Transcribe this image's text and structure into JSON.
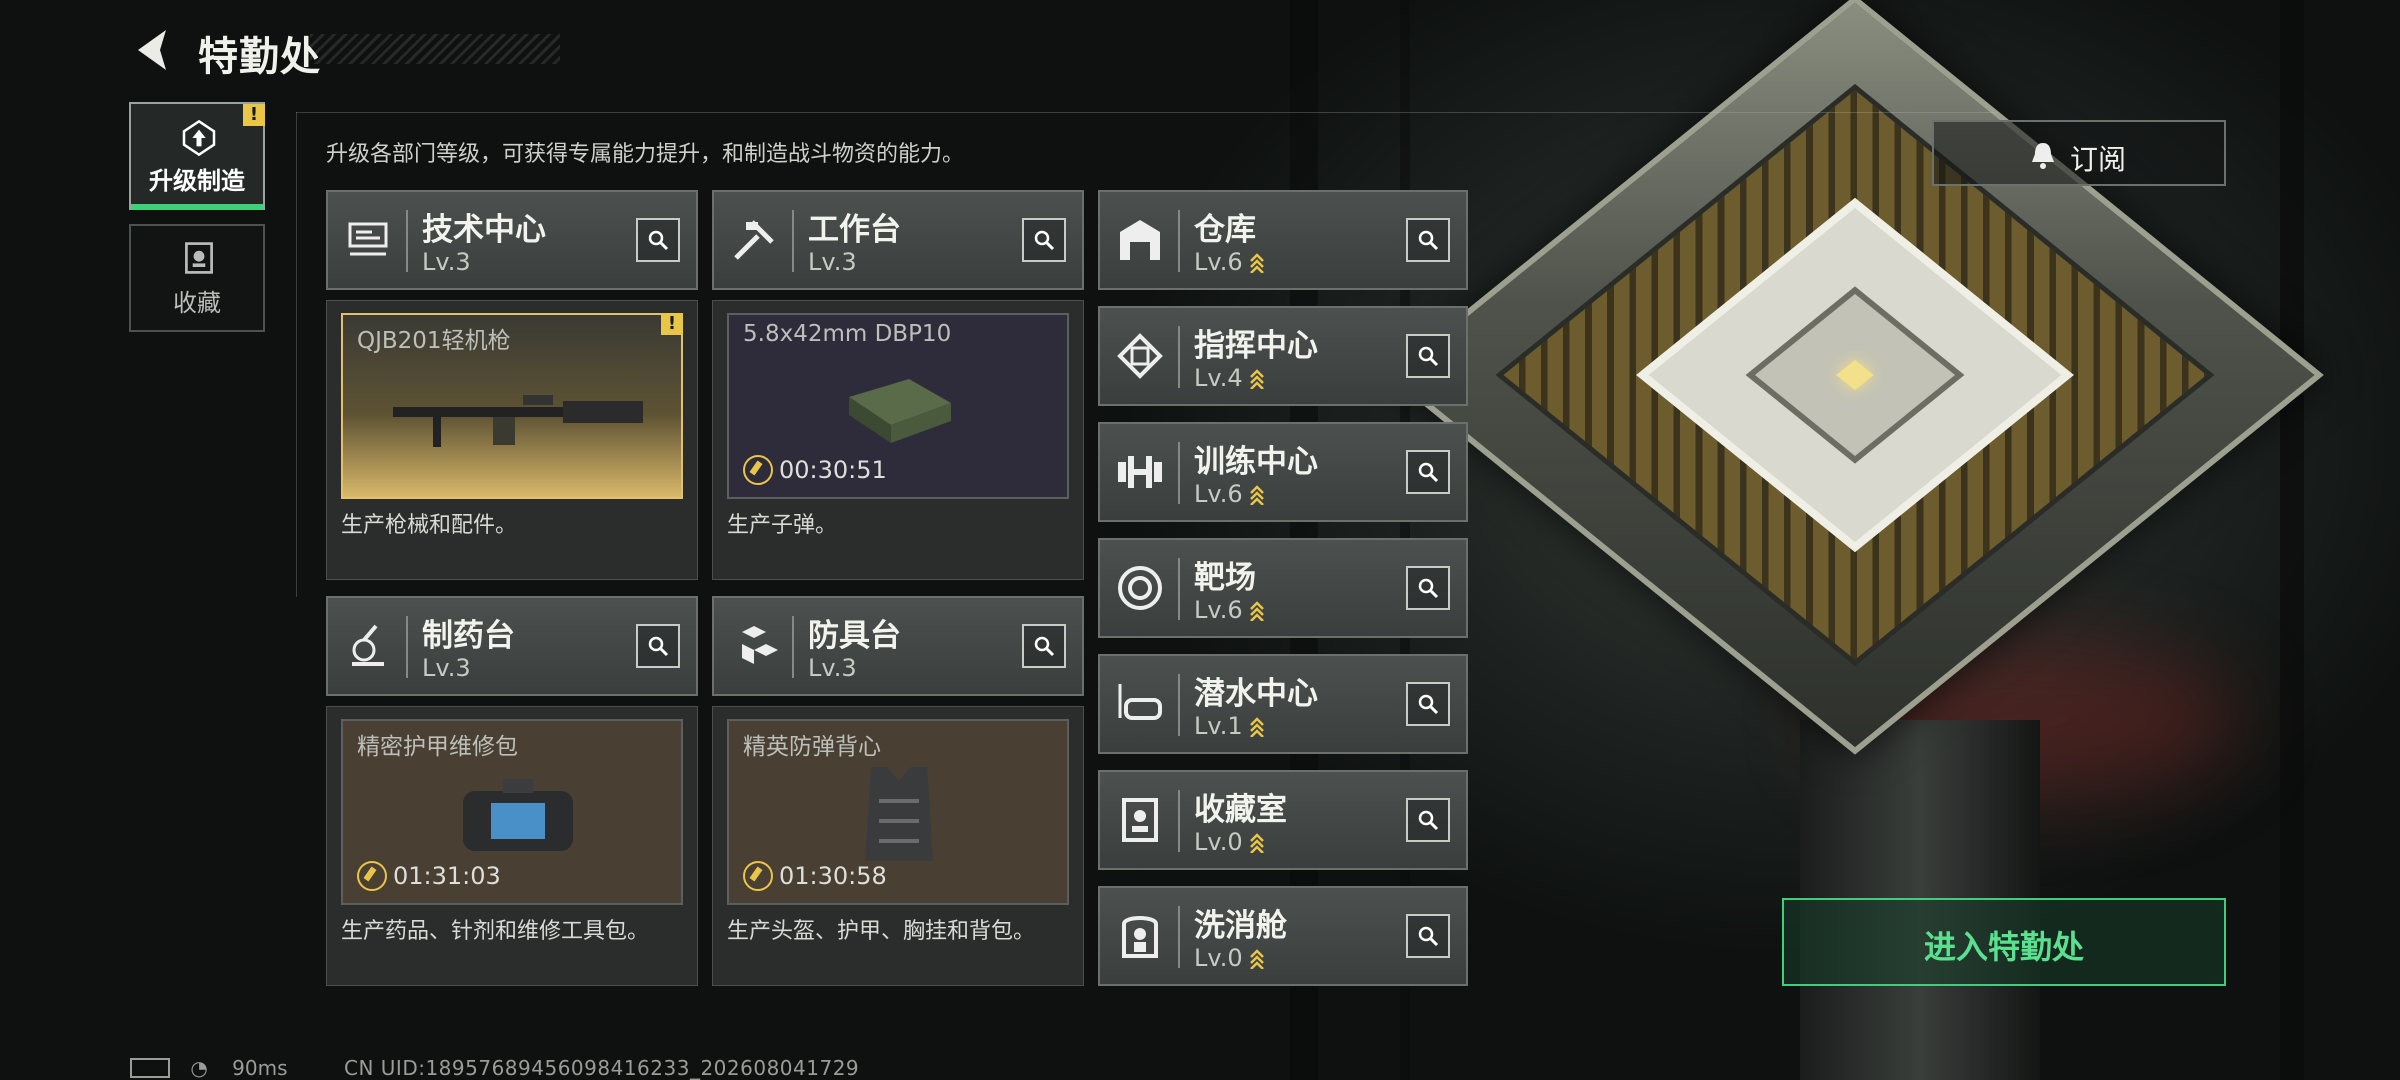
{
  "header": {
    "title": "特勤处"
  },
  "sidebar": {
    "tabs": [
      {
        "label": "升级制造",
        "icon": "upgrade-icon",
        "active": true,
        "alert": "!"
      },
      {
        "label": "收藏",
        "icon": "collection-icon",
        "active": false
      }
    ]
  },
  "main": {
    "subtitle": "升级各部门等级，可获得专属能力提升，和制造战斗物资的能力。"
  },
  "departments_with_production": [
    {
      "name": "技术中心",
      "level": "Lv.3",
      "icon": "circuit-board-icon",
      "production": {
        "item": "QJB201轻机枪",
        "timer": "",
        "alert": "!"
      },
      "description": "生产枪械和配件。"
    },
    {
      "name": "工作台",
      "level": "Lv.3",
      "icon": "tools-icon",
      "production": {
        "item": "5.8x42mm DBP10",
        "timer": "00:30:51"
      },
      "description": "生产子弹。"
    },
    {
      "name": "制药台",
      "level": "Lv.3",
      "icon": "microscope-icon",
      "production": {
        "item": "精密护甲维修包",
        "timer": "01:31:03"
      },
      "description": "生产药品、针剂和维修工具包。"
    },
    {
      "name": "防具台",
      "level": "Lv.3",
      "icon": "armor-blocks-icon",
      "production": {
        "item": "精英防弹背心",
        "timer": "01:30:58"
      },
      "description": "生产头盔、护甲、胸挂和背包。"
    }
  ],
  "departments": [
    {
      "name": "仓库",
      "level": "Lv.6",
      "icon": "warehouse-icon"
    },
    {
      "name": "指挥中心",
      "level": "Lv.4",
      "icon": "command-chip-icon"
    },
    {
      "name": "训练中心",
      "level": "Lv.6",
      "icon": "dumbbell-icon"
    },
    {
      "name": "靶场",
      "level": "Lv.6",
      "icon": "target-icon"
    },
    {
      "name": "潜水中心",
      "level": "Lv.1",
      "icon": "diving-mask-icon"
    },
    {
      "name": "收藏室",
      "level": "Lv.0",
      "icon": "display-case-icon"
    },
    {
      "name": "洗消舱",
      "level": "Lv.0",
      "icon": "decon-chamber-icon"
    }
  ],
  "actions": {
    "subscribe_label": "订阅",
    "enter_label": "进入特勤处"
  },
  "status_bar": {
    "ping": "90ms",
    "uid": "CN UID:18957689456098416233_202608041729"
  },
  "colors": {
    "accent_green": "#3ecf7a",
    "alert_yellow": "#e9c548",
    "upgrade_gold": "#e9c548"
  }
}
